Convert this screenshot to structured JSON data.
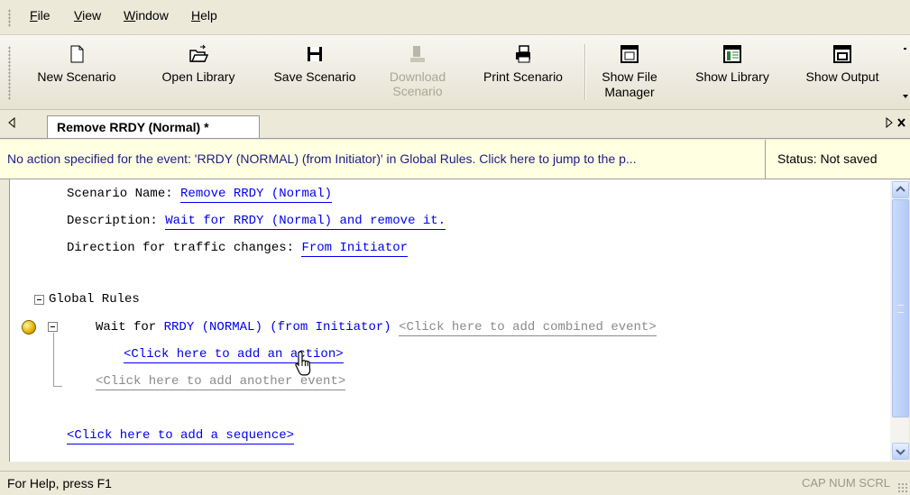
{
  "menu": {
    "items": [
      {
        "u": "F",
        "rest": "ile"
      },
      {
        "u": "V",
        "rest": "iew"
      },
      {
        "u": "W",
        "rest": "indow"
      },
      {
        "u": "H",
        "rest": "elp"
      }
    ]
  },
  "toolbar": {
    "buttons": [
      {
        "label": "New Scenario",
        "icon": "new-document-icon"
      },
      {
        "label": "Open Library",
        "icon": "open-folder-icon"
      },
      {
        "label": "Save Scenario",
        "icon": "floppy-disk-icon"
      },
      {
        "label": "Download Scenario",
        "icon": "download-icon",
        "disabled": true
      },
      {
        "label": "Print Scenario",
        "icon": "printer-icon"
      },
      {
        "label": "Show File Manager",
        "icon": "window-icon"
      },
      {
        "label": "Show Library",
        "icon": "library-window-icon"
      },
      {
        "label": "Show Output",
        "icon": "output-window-icon"
      }
    ]
  },
  "tabs": {
    "active_label": "Remove RRDY (Normal) *"
  },
  "infobar": {
    "message": "No action specified for the event: 'RRDY (NORMAL) (from Initiator)' in Global Rules.  Click here to jump to the p...",
    "status": "Status: Not saved"
  },
  "editor": {
    "scenario_name_label": "Scenario Name:",
    "scenario_name_value": "Remove RRDY (Normal)",
    "description_label": "Description:",
    "description_value": "Wait for RRDY (Normal) and remove it.",
    "direction_label": "Direction for traffic changes:",
    "direction_value": "From Initiator",
    "global_rules_label": "Global Rules",
    "wait_for_label": "Wait for",
    "event_name": "RRDY (NORMAL) (from Initiator)",
    "add_combined_event": "<Click here to add combined event>",
    "add_action": "<Click here to add an action>",
    "add_another_event": "<Click here to add another event>",
    "add_sequence": "<Click here to add a sequence>"
  },
  "statusbar": {
    "help_text": "For Help, press F1",
    "indicators": "CAP  NUM  SCRL"
  }
}
